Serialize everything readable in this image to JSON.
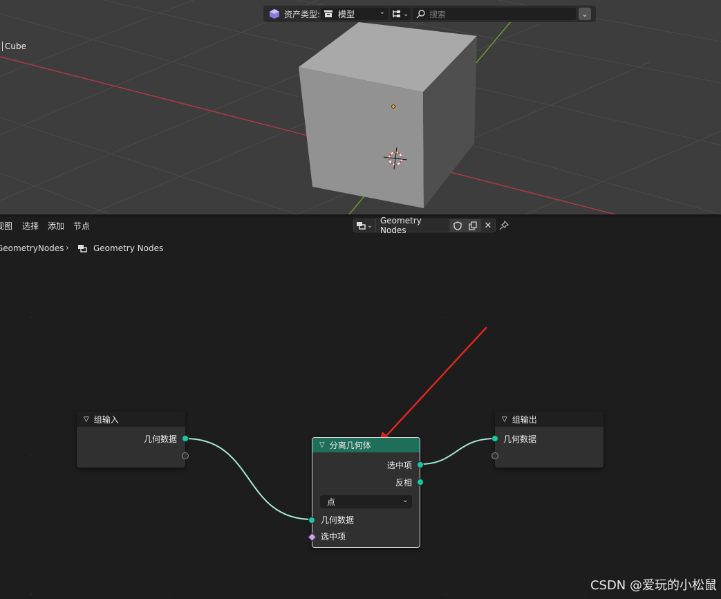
{
  "colors": {
    "viewport_bg": "#3d3d3d",
    "editor_bg": "#1d1d1d",
    "node_bg": "#303030",
    "geometry_node_header": "#1e6e5a",
    "geometry_socket": "#21c4a1",
    "link": "#a8e6d4",
    "annotation_arrow": "#e0251f",
    "x_axis": "#a83b45",
    "y_axis": "#6b9a2c"
  },
  "viewport": {
    "asset_type_label": "资产类型:",
    "asset_type_value": "模型",
    "search_placeholder": "搜索",
    "object_name": "Cube"
  },
  "node_editor": {
    "menus": [
      "视图",
      "选择",
      "添加",
      "节点"
    ],
    "tree_name": "Geometry Nodes",
    "breadcrumb_parent": "GeometryNodes",
    "breadcrumb_current": "Geometry Nodes"
  },
  "nodes": {
    "group_input": {
      "title": "组输入",
      "output": "几何数据"
    },
    "separate": {
      "title": "分离几何体",
      "out_selection": "选中项",
      "out_inverted": "反相",
      "domain": "点",
      "in_geometry": "几何数据",
      "in_selection": "选中项"
    },
    "group_output": {
      "title": "组输出",
      "input": "几何数据"
    }
  },
  "watermark": "CSDN @爱玩的小松鼠"
}
